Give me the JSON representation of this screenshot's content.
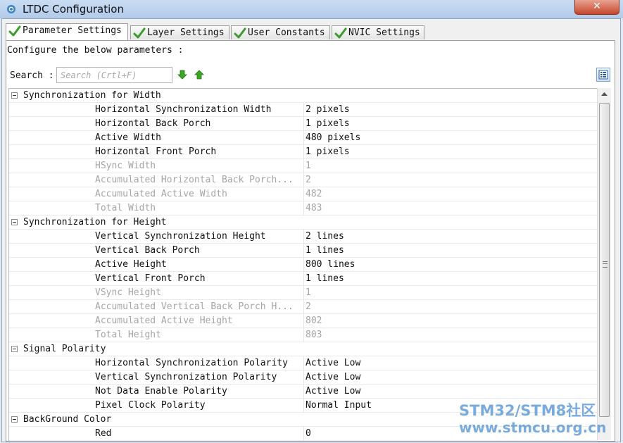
{
  "window": {
    "title": "LTDC Configuration",
    "close_label": "✕"
  },
  "tabs": [
    {
      "label": "Parameter Settings",
      "active": true
    },
    {
      "label": "Layer Settings",
      "active": false
    },
    {
      "label": "User Constants",
      "active": false
    },
    {
      "label": "NVIC Settings",
      "active": false
    }
  ],
  "configure_text": "Configure the below parameters :",
  "search": {
    "label": "Search :",
    "placeholder": "Search (Crtl+F)"
  },
  "colors": {
    "check_green": "#3c9a2e",
    "arrow_green": "#3aa521",
    "watermark": "#5494d6"
  },
  "groups": [
    {
      "name": "Synchronization for Width",
      "rows": [
        {
          "name": "Horizontal Synchronization Width",
          "value": "2 pixels",
          "readonly": false
        },
        {
          "name": "Horizontal Back Porch",
          "value": "1 pixels",
          "readonly": false
        },
        {
          "name": "Active Width",
          "value": "480 pixels",
          "readonly": false
        },
        {
          "name": "Horizontal Front Porch",
          "value": "1 pixels",
          "readonly": false
        },
        {
          "name": "HSync Width",
          "value": "1",
          "readonly": true
        },
        {
          "name": "Accumulated Horizontal Back Porch...",
          "value": "2",
          "readonly": true
        },
        {
          "name": "Accumulated Active Width",
          "value": "482",
          "readonly": true
        },
        {
          "name": "Total Width",
          "value": "483",
          "readonly": true
        }
      ]
    },
    {
      "name": "Synchronization for Height",
      "rows": [
        {
          "name": "Vertical Synchronization Height",
          "value": "2 lines",
          "readonly": false
        },
        {
          "name": "Vertical Back Porch",
          "value": "1 lines",
          "readonly": false
        },
        {
          "name": "Active Height",
          "value": "800 lines",
          "readonly": false
        },
        {
          "name": "Vertical Front Porch",
          "value": "1 lines",
          "readonly": false
        },
        {
          "name": "VSync Height",
          "value": "1",
          "readonly": true
        },
        {
          "name": "Accumulated Vertical Back Porch H...",
          "value": "2",
          "readonly": true
        },
        {
          "name": "Accumulated Active Height",
          "value": "802",
          "readonly": true
        },
        {
          "name": "Total Height",
          "value": "803",
          "readonly": true
        }
      ]
    },
    {
      "name": "Signal Polarity",
      "rows": [
        {
          "name": "Horizontal Synchronization Polarity",
          "value": "Active Low",
          "readonly": false
        },
        {
          "name": "Vertical Synchronization Polarity",
          "value": "Active Low",
          "readonly": false
        },
        {
          "name": "Not Data Enable Polarity",
          "value": "Active Low",
          "readonly": false
        },
        {
          "name": "Pixel Clock Polarity",
          "value": "Normal Input",
          "readonly": false
        }
      ]
    },
    {
      "name": "BackGround Color",
      "rows": [
        {
          "name": "Red",
          "value": "0",
          "readonly": false
        }
      ]
    }
  ],
  "watermark": {
    "line1": "STM32/STM8社区",
    "line2": "www.stmcu.org.cn"
  }
}
